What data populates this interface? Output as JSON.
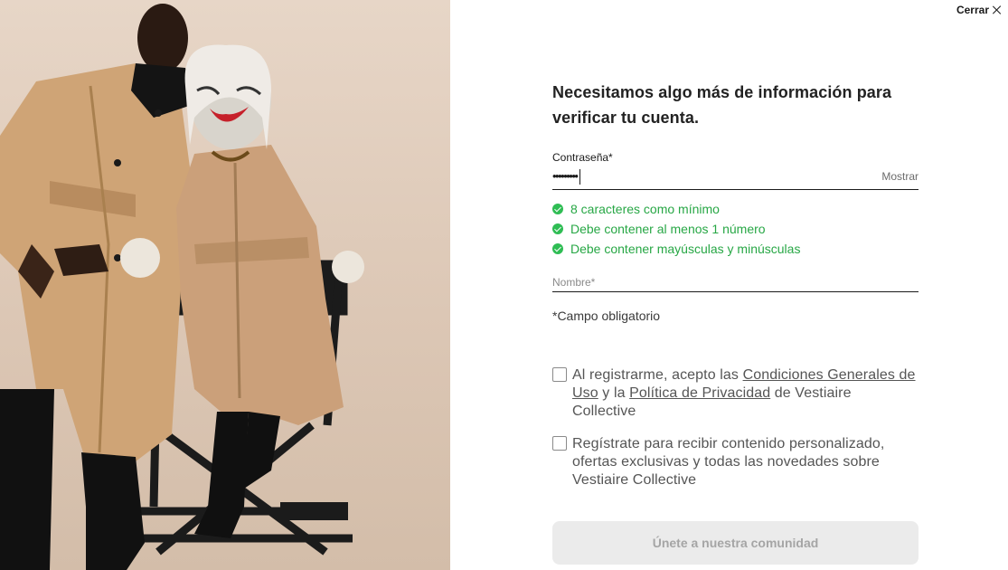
{
  "close": {
    "label": "Cerrar",
    "icon": "close-icon"
  },
  "heading": "Necesitamos algo más de información para verificar tu cuenta.",
  "password": {
    "label": "Contraseña*",
    "value": "•••••••••",
    "show_label": "Mostrar"
  },
  "rules": [
    {
      "text": "8 caracteres como mínimo",
      "icon": "check-circle-icon"
    },
    {
      "text": "Debe contener al menos 1 número",
      "icon": "check-circle-icon"
    },
    {
      "text": "Debe contener mayúsculas y minúsculas",
      "icon": "check-circle-icon"
    }
  ],
  "name_field": {
    "placeholder": "Nombre*",
    "value": ""
  },
  "required_note": "*Campo obligatorio",
  "terms": {
    "prefix": "Al registrarme, acepto las ",
    "link1": "Condiciones Generales de Uso",
    "middle": " y la ",
    "link2": "Política de Privacidad",
    "suffix": " de Vestiaire Collective",
    "checked": false
  },
  "newsletter": {
    "text": "Regístrate para recibir contenido personalizado, ofertas exclusivas y todas las novedades sobre Vestiaire Collective",
    "checked": false
  },
  "submit_label": "Únete a nuestra comunidad",
  "colors": {
    "success": "#27a745",
    "button_bg": "#ebebeb",
    "button_text": "#a5a5a5",
    "trench_coat": "#cfa476"
  }
}
